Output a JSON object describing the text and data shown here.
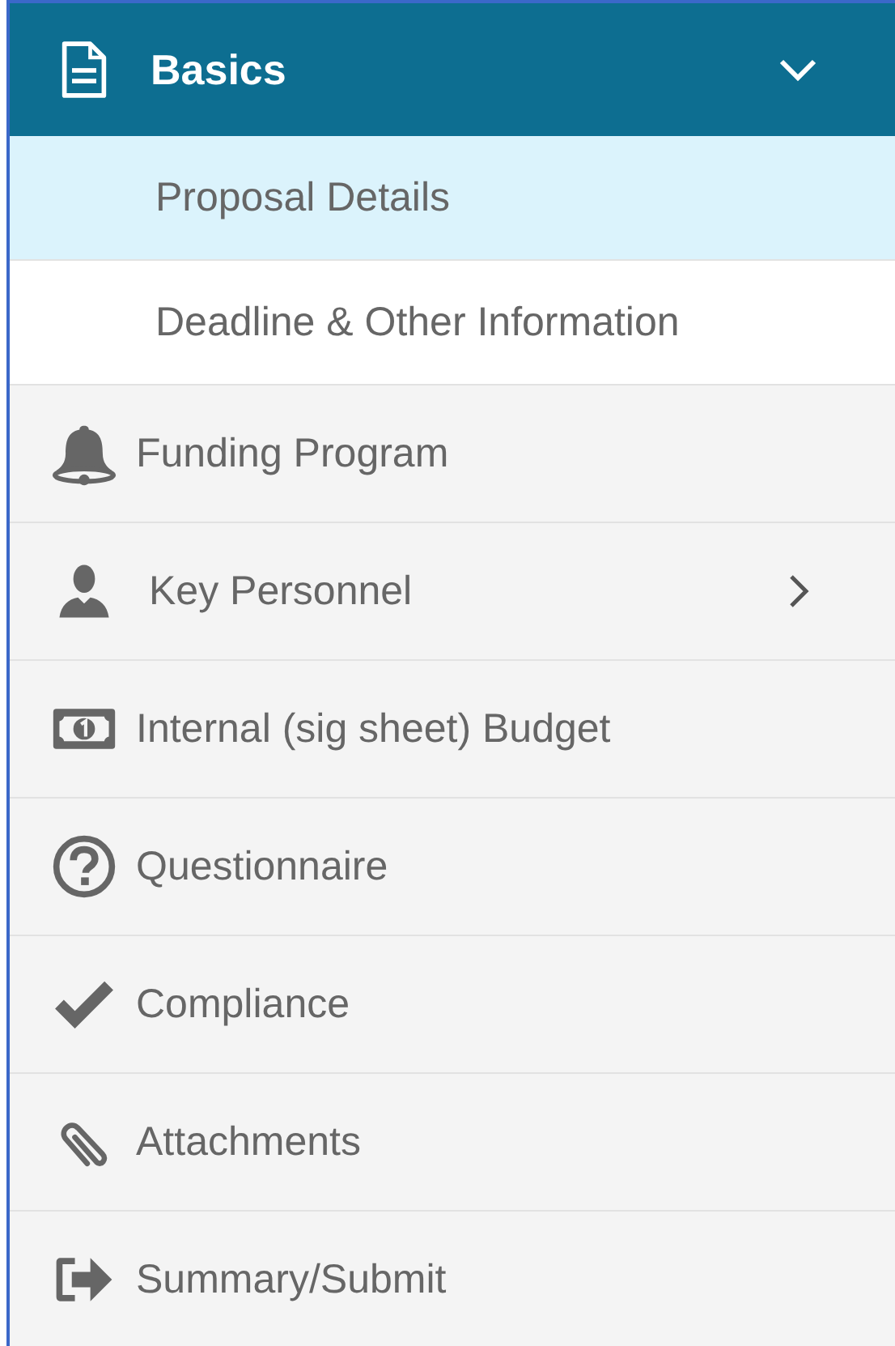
{
  "menu": {
    "header": {
      "label": "Basics",
      "expanded": true,
      "children": [
        {
          "label": "Proposal Details",
          "selected": true
        },
        {
          "label": "Deadline & Other Information",
          "selected": false
        }
      ]
    },
    "items": [
      {
        "label": "Funding Program",
        "expandable": false
      },
      {
        "label": "Key Personnel",
        "expandable": true
      },
      {
        "label": "Internal (sig sheet) Budget",
        "expandable": false
      },
      {
        "label": "Questionnaire",
        "expandable": false
      },
      {
        "label": "Compliance",
        "expandable": false
      },
      {
        "label": "Attachments",
        "expandable": false
      },
      {
        "label": "Summary/Submit",
        "expandable": false
      }
    ]
  }
}
